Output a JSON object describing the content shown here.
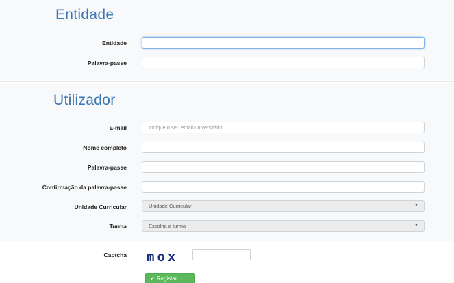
{
  "entidade_section": {
    "title": "Entidade",
    "entidade_label": "Entidade",
    "entidade_value": "",
    "password_label": "Palavra-passe",
    "password_value": ""
  },
  "utilizador_section": {
    "title": "Utilizador",
    "email_label": "E-mail",
    "email_placeholder": "Indique o seu email universitário",
    "fullname_label": "Nome completo",
    "password_label": "Palavra-passe",
    "confirm_password_label": "Confirmação da palavra-passe",
    "course_unit_label": "Unidade Curricular",
    "course_unit_selected": "Unidade Curricular",
    "class_label": "Turma",
    "class_selected": "Escolha a turma"
  },
  "captcha": {
    "label": "Captcha",
    "image_text": "mox",
    "input_value": ""
  },
  "submit": {
    "icon": "check-icon",
    "label": "Registar",
    "color": "#5cb85c"
  },
  "colors": {
    "title": "#3a77b5",
    "focus": "#7fb2e6"
  }
}
